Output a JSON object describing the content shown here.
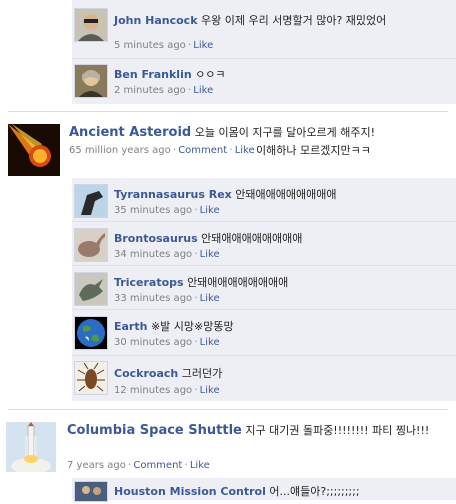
{
  "block1": {
    "c1": {
      "name": "John Hancock",
      "text": "우왕 이제 우리 서명할거 많아? 재밌었어",
      "time": "5 minutes ago",
      "like": "Like"
    },
    "c2": {
      "name": "Ben Franklin",
      "text": "ㅇㅇㅋ",
      "time": "2 minutes ago",
      "like": "Like"
    }
  },
  "post1": {
    "name": "Ancient Asteroid",
    "text": "오늘 이몸이 지구를 달아오르게 해주지!",
    "text2": "이해하나 모르겠지만ㅋㅋ",
    "time": "65 million years ago",
    "comment": "Comment",
    "like": "Like"
  },
  "block2": {
    "c1": {
      "name": "Tyrannasaurus Rex",
      "text": "안돼애애애애애애애애",
      "time": "35 minutes ago",
      "like": "Like"
    },
    "c2": {
      "name": "Brontosaurus",
      "text": "안돼애애애애애애애애",
      "time": "34 minutes ago",
      "like": "Like"
    },
    "c3": {
      "name": "Triceratops",
      "text": "안돼애애애애애애애애",
      "time": "33 minutes ago",
      "like": "Like"
    },
    "c4": {
      "name": "Earth",
      "text": "※발 시망※망똥망",
      "time": "30 minutes ago",
      "like": "Like"
    },
    "c5": {
      "name": "Cockroach",
      "text": "그러던가",
      "time": "12 minutes ago",
      "like": "Like"
    }
  },
  "post2": {
    "name": "Columbia Space Shuttle",
    "text": "지구 대기권 돌파중!!!!!!!! 파티 찡나!!!",
    "time": "7 years ago",
    "comment": "Comment",
    "like": "Like"
  },
  "block3": {
    "c1": {
      "name": "Houston Mission Control",
      "text": "어...얘들아?;;;;;;;;;"
    }
  }
}
